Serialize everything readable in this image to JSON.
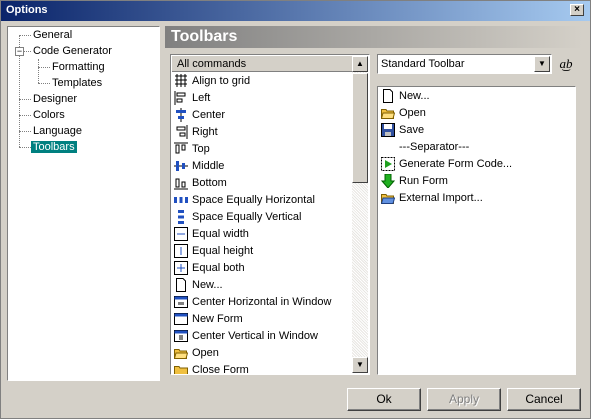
{
  "window": {
    "title": "Options"
  },
  "tree": {
    "items": [
      {
        "label": "General"
      },
      {
        "label": "Code Generator",
        "expander": "−"
      },
      {
        "label": "Formatting"
      },
      {
        "label": "Templates"
      },
      {
        "label": "Designer"
      },
      {
        "label": "Colors"
      },
      {
        "label": "Language"
      },
      {
        "label": "Toolbars",
        "selected": true
      }
    ]
  },
  "section": {
    "title": "Toolbars"
  },
  "commands": {
    "header": "All commands",
    "items": [
      {
        "label": "Align to grid",
        "icon": "grid-icon"
      },
      {
        "label": "Left",
        "icon": "align-left-icon"
      },
      {
        "label": "Center",
        "icon": "align-center-icon"
      },
      {
        "label": "Right",
        "icon": "align-right-icon"
      },
      {
        "label": "Top",
        "icon": "align-top-icon"
      },
      {
        "label": "Middle",
        "icon": "align-middle-icon"
      },
      {
        "label": "Bottom",
        "icon": "align-bottom-icon"
      },
      {
        "label": "Space Equally Horizontal",
        "icon": "space-horizontal-icon"
      },
      {
        "label": "Space Equally Vertical",
        "icon": "space-vertical-icon"
      },
      {
        "label": "Equal width",
        "icon": "equal-width-icon"
      },
      {
        "label": "Equal height",
        "icon": "equal-height-icon"
      },
      {
        "label": "Equal both",
        "icon": "equal-both-icon"
      },
      {
        "label": "New...",
        "icon": "new-document-icon"
      },
      {
        "label": "Center Horizontal in Window",
        "icon": "center-horizontal-icon"
      },
      {
        "label": "New Form",
        "icon": "new-form-icon"
      },
      {
        "label": "Center Vertical in Window",
        "icon": "center-vertical-icon"
      },
      {
        "label": "Open",
        "icon": "open-folder-icon"
      },
      {
        "label": "Close Form",
        "icon": "folder-icon"
      }
    ]
  },
  "toolbar_select": {
    "value": "Standard Toolbar",
    "rename_label": "a͜b"
  },
  "toolbar_items": [
    {
      "label": "New...",
      "icon": "new-document-icon"
    },
    {
      "label": "Open",
      "icon": "open-folder-icon"
    },
    {
      "label": "Save",
      "icon": "save-icon"
    },
    {
      "label": "---Separator---",
      "icon": ""
    },
    {
      "label": "Generate Form Code...",
      "icon": "generate-code-icon"
    },
    {
      "label": "Run Form",
      "icon": "run-arrow-icon"
    },
    {
      "label": "External Import...",
      "icon": "import-folder-icon"
    }
  ],
  "buttons": {
    "ok": "Ok",
    "apply": "Apply",
    "cancel": "Cancel"
  }
}
